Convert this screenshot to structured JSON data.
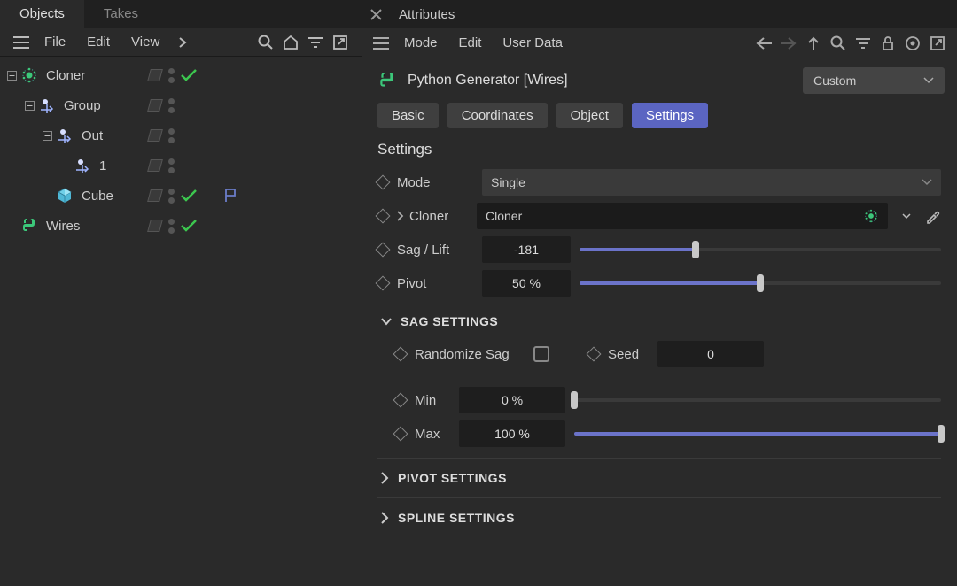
{
  "left": {
    "tabs": [
      "Objects",
      "Takes"
    ],
    "menu": [
      "File",
      "Edit",
      "View"
    ],
    "tree": [
      {
        "label": "Cloner",
        "depth": 0,
        "icon": "cloner",
        "expander": "minus",
        "check": true
      },
      {
        "label": "Group",
        "depth": 1,
        "icon": "null",
        "expander": "minus",
        "check": false
      },
      {
        "label": "Out",
        "depth": 2,
        "icon": "null",
        "expander": "minus",
        "check": false
      },
      {
        "label": "1",
        "depth": 3,
        "icon": "null",
        "expander": "none",
        "check": false
      },
      {
        "label": "Cube",
        "depth": 2,
        "icon": "cube",
        "expander": "none",
        "check": true,
        "flag": true
      },
      {
        "label": "Wires",
        "depth": 0,
        "icon": "python",
        "expander": "none",
        "check": true
      }
    ]
  },
  "right": {
    "title": "Attributes",
    "menu": [
      "Mode",
      "Edit",
      "User Data"
    ],
    "object_name": "Python Generator [Wires]",
    "preset": "Custom",
    "tabs": [
      "Basic",
      "Coordinates",
      "Object",
      "Settings"
    ],
    "active_tab": "Settings",
    "section": "Settings",
    "mode": {
      "label": "Mode",
      "value": "Single"
    },
    "cloner": {
      "label": "Cloner",
      "value": "Cloner"
    },
    "sag": {
      "label": "Sag / Lift",
      "value": "-181",
      "pct": 32
    },
    "pivot": {
      "label": "Pivot",
      "value": "50 %",
      "pct": 50
    },
    "group_sag": "SAG SETTINGS",
    "randomize": {
      "label": "Randomize Sag"
    },
    "seed": {
      "label": "Seed",
      "value": "0"
    },
    "min": {
      "label": "Min",
      "value": "0 %",
      "pct": 0
    },
    "max": {
      "label": "Max",
      "value": "100 %",
      "pct": 100
    },
    "group_pivot": "PIVOT SETTINGS",
    "group_spline": "SPLINE SETTINGS"
  }
}
